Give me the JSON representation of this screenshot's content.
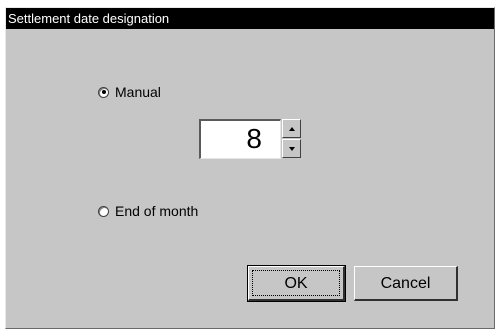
{
  "window": {
    "title": "Settlement date designation"
  },
  "options": {
    "manual": {
      "label": "Manual",
      "checked": true
    },
    "end_of_month": {
      "label": "End of month",
      "checked": false
    }
  },
  "spinner": {
    "value": "8",
    "up_icon": "arrow-up-icon",
    "down_icon": "arrow-down-icon"
  },
  "buttons": {
    "ok_label": "OK",
    "cancel_label": "Cancel"
  },
  "colors": {
    "dialog_background": "#c6c6c6",
    "title_bar": "#000000",
    "title_text": "#ffffff",
    "field_background": "#ffffff"
  }
}
